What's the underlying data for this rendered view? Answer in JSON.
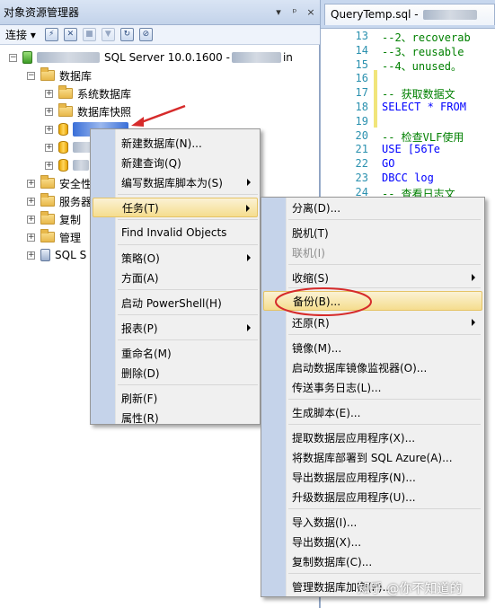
{
  "object_explorer": {
    "title": "对象资源管理器",
    "pin_label": "▼ ᵖ ×",
    "toolbar": {
      "connect_label": "连接 ▾"
    },
    "tree": {
      "server_label": "SQL Server 10.0.1600 -",
      "server_suffix": "in",
      "databases": "数据库",
      "system_databases": "系统数据库",
      "snapshots": "数据库快照",
      "security": "安全性",
      "server_objects": "服务器",
      "replication": "复制",
      "management": "管理",
      "agent": "SQL S"
    }
  },
  "editor": {
    "tab_title": "QueryTemp.sql -",
    "lines": [
      {
        "n": "13",
        "text": "--2、recoverab",
        "cls": "cm"
      },
      {
        "n": "14",
        "text": "--3、reusable ",
        "cls": "cm"
      },
      {
        "n": "15",
        "text": "--4、unused。 ",
        "cls": "cm"
      },
      {
        "n": "16",
        "text": "",
        "cls": "cm"
      },
      {
        "n": "17",
        "text": "-- 获取数据文",
        "cls": "cm"
      },
      {
        "n": "18",
        "text": "SELECT * FROM ",
        "cls": "kw"
      },
      {
        "n": "19",
        "text": "",
        "cls": "cm"
      },
      {
        "n": "20",
        "text": "-- 检查VLF使用",
        "cls": "cm"
      },
      {
        "n": "21",
        "text": "  USE [56Te",
        "cls": "kw"
      },
      {
        "n": "22",
        "text": "  GO",
        "cls": "kw"
      },
      {
        "n": "23",
        "text": "  DBCC log",
        "cls": "kw"
      },
      {
        "n": "24",
        "text": "-- 查看日志文",
        "cls": "cm"
      }
    ]
  },
  "context_menu": {
    "items": [
      {
        "label": "新建数据库(N)...",
        "arrow": false
      },
      {
        "label": "新建查询(Q)",
        "arrow": false
      },
      {
        "label": "编写数据库脚本为(S)",
        "arrow": true
      },
      {
        "label": "任务(T)",
        "arrow": true
      },
      {
        "label": "Find Invalid Objects",
        "arrow": false
      },
      {
        "label": "策略(O)",
        "arrow": true
      },
      {
        "label": "方面(A)",
        "arrow": false
      },
      {
        "label": "启动 PowerShell(H)",
        "arrow": false
      },
      {
        "label": "报表(P)",
        "arrow": true
      },
      {
        "label": "重命名(M)",
        "arrow": false
      },
      {
        "label": "删除(D)",
        "arrow": false
      },
      {
        "label": "刷新(F)",
        "arrow": false
      },
      {
        "label": "属性(R)",
        "arrow": false
      }
    ]
  },
  "tasks_submenu": {
    "items": [
      {
        "label": "分离(D)..."
      },
      {
        "label": "脱机(T)"
      },
      {
        "label": "联机(I)"
      },
      {
        "label": "收缩(S)"
      },
      {
        "label": "备份(B)..."
      },
      {
        "label": "还原(R)"
      },
      {
        "label": "镜像(M)..."
      },
      {
        "label": "启动数据库镜像监视器(O)..."
      },
      {
        "label": "传送事务日志(L)..."
      },
      {
        "label": "生成脚本(E)..."
      },
      {
        "label": "提取数据层应用程序(X)..."
      },
      {
        "label": "将数据库部署到 SQL Azure(A)..."
      },
      {
        "label": "导出数据层应用程序(N)..."
      },
      {
        "label": "升级数据层应用程序(U)..."
      },
      {
        "label": "导入数据(I)..."
      },
      {
        "label": "导出数据(X)..."
      },
      {
        "label": "复制数据库(C)..."
      },
      {
        "label": "管理数据库加密(P)..."
      }
    ]
  },
  "watermark": "知乎 @你不知道的",
  "colors": {
    "highlight_circle": "#d62b2b",
    "selection": "#3a6fd8",
    "arrow": "#d62b2b"
  }
}
